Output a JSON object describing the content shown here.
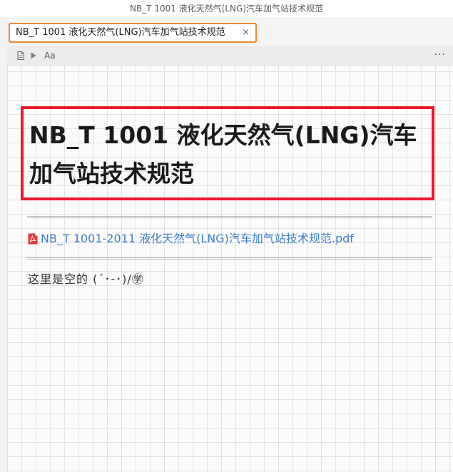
{
  "window": {
    "title": "NB_T 1001 液化天然气(LNG)汽车加气站技术规范"
  },
  "tabs": [
    {
      "label": "NB_T 1001 液化天然气(LNG)汽车加气站技术规范",
      "close": "×",
      "active": true
    }
  ],
  "toolbar": {
    "icons": [
      "document-icon",
      "play-icon"
    ],
    "font_label": "Aa",
    "more_label": "···"
  },
  "document": {
    "title": "NB_T 1001 液化天然气(LNG)汽车加气站技术规范",
    "attachment": {
      "icon": "pdf-icon",
      "label": "NB_T 1001-2011 液化天然气(LNG)汽车加气站技术规范.pdf"
    },
    "empty_note": "这里是空的 (´･-･)/㊫"
  },
  "colors": {
    "tab_border": "#f08a2e",
    "highlight_box": "#e8192c",
    "link": "#3d7fd1",
    "pdf_icon": "#e03a3a"
  }
}
